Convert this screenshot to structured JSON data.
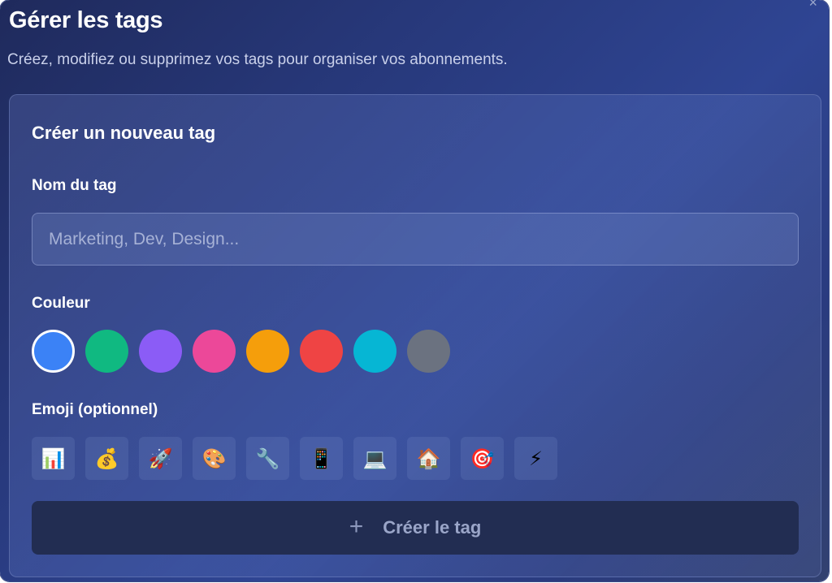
{
  "dialog": {
    "title": "Gérer les tags",
    "subtitle": "Créez, modifiez ou supprimez vos tags pour organiser vos abonnements.",
    "close_glyph": "×"
  },
  "form": {
    "section_title": "Créer un nouveau tag",
    "name_label": "Nom du tag",
    "name_value": "",
    "name_placeholder": "Marketing, Dev, Design...",
    "color_label": "Couleur",
    "colors": [
      {
        "name": "blue",
        "hex": "#3b82f6",
        "selected": true
      },
      {
        "name": "green",
        "hex": "#10b981",
        "selected": false
      },
      {
        "name": "purple",
        "hex": "#8b5cf6",
        "selected": false
      },
      {
        "name": "pink",
        "hex": "#ec4899",
        "selected": false
      },
      {
        "name": "orange",
        "hex": "#f59e0b",
        "selected": false
      },
      {
        "name": "red",
        "hex": "#ef4444",
        "selected": false
      },
      {
        "name": "cyan",
        "hex": "#06b6d4",
        "selected": false
      },
      {
        "name": "gray",
        "hex": "#6b7280",
        "selected": false
      }
    ],
    "emoji_label": "Emoji (optionnel)",
    "emojis": [
      {
        "name": "bar-chart-emoji",
        "glyph": "📊"
      },
      {
        "name": "money-bag-emoji",
        "glyph": "💰"
      },
      {
        "name": "rocket-emoji",
        "glyph": "🚀"
      },
      {
        "name": "palette-emoji",
        "glyph": "🎨"
      },
      {
        "name": "wrench-emoji",
        "glyph": "🔧"
      },
      {
        "name": "mobile-phone-emoji",
        "glyph": "📱"
      },
      {
        "name": "laptop-emoji",
        "glyph": "💻"
      },
      {
        "name": "house-emoji",
        "glyph": "🏠"
      },
      {
        "name": "target-emoji",
        "glyph": "🎯"
      },
      {
        "name": "lightning-emoji",
        "glyph": "⚡"
      }
    ],
    "submit_icon": "+",
    "submit_label": "Créer le tag"
  },
  "theme": {
    "accent": "#3b82f6",
    "button_bg": "#222d52"
  }
}
